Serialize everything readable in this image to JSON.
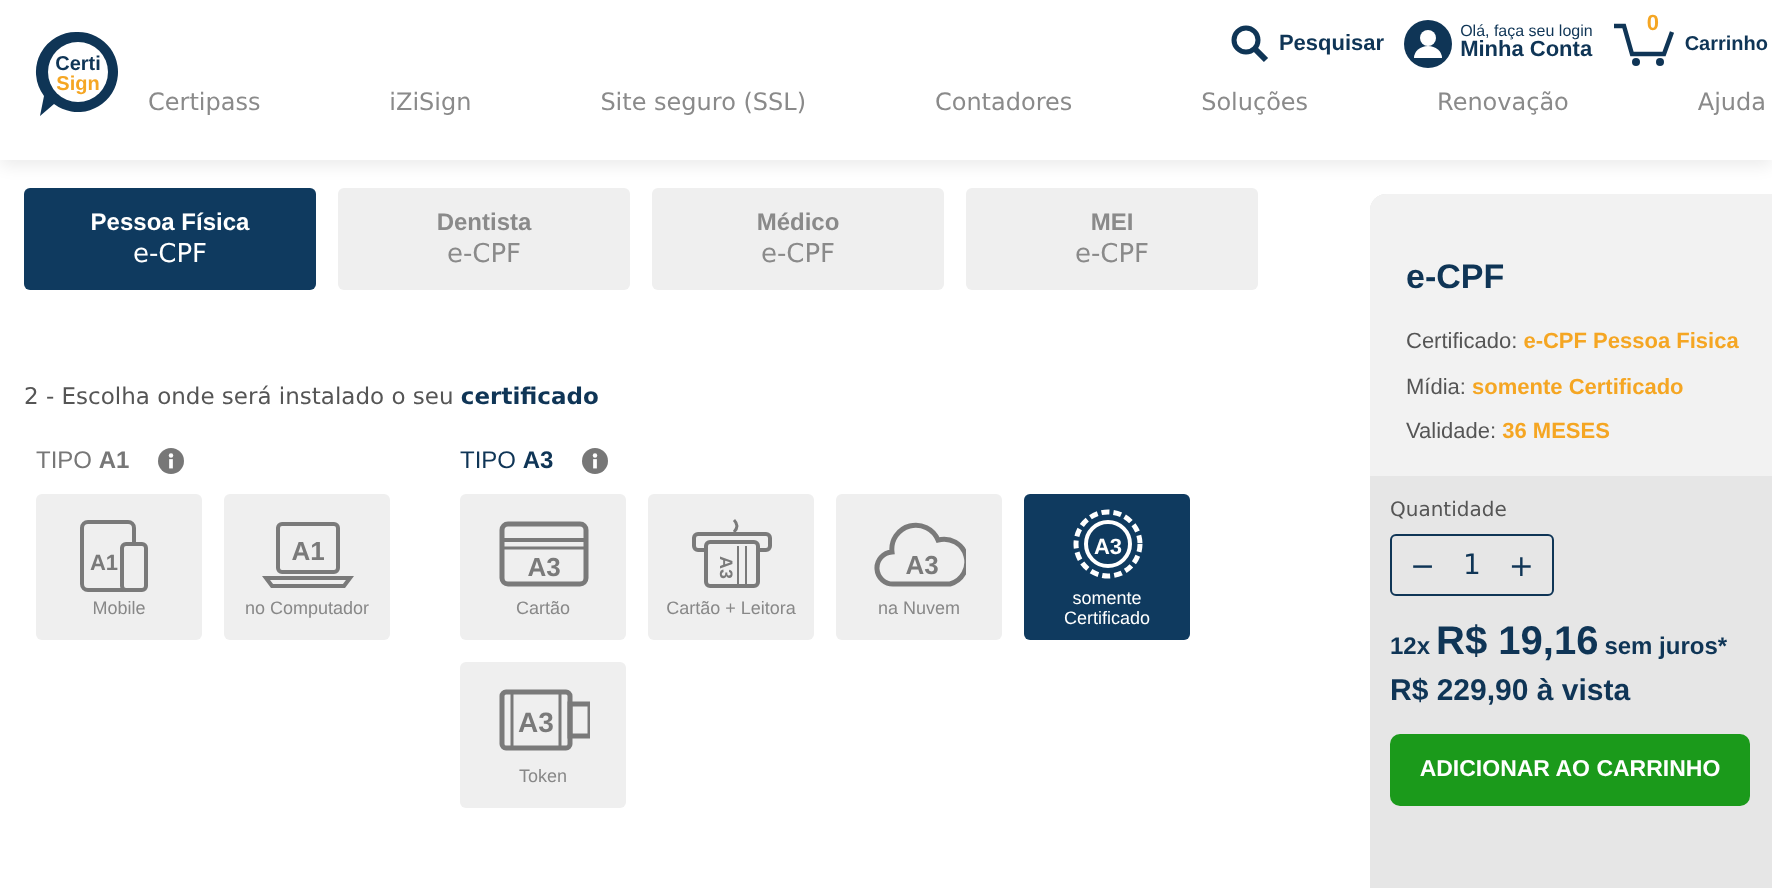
{
  "header": {
    "logo": {
      "line1": "Certi",
      "line2": "Sign"
    },
    "nav": [
      "Certipass",
      "iZiSign",
      "Site seguro (SSL)",
      "Contadores",
      "Soluções",
      "Renovação",
      "Ajuda"
    ],
    "search": {
      "label": "Pesquisar"
    },
    "account": {
      "greeting": "Olá, faça seu login",
      "label": "Minha Conta"
    },
    "cart": {
      "count": "0",
      "label": "Carrinho"
    }
  },
  "tabs": [
    {
      "title": "Pessoa Física",
      "subtitle": "e-CPF",
      "selected": true
    },
    {
      "title": "Dentista",
      "subtitle": "e-CPF",
      "selected": false
    },
    {
      "title": "Médico",
      "subtitle": "e-CPF",
      "selected": false
    },
    {
      "title": "MEI",
      "subtitle": "e-CPF",
      "selected": false
    }
  ],
  "instruction": "2 - Escolha onde será instalado o seu **certificado**",
  "groups": [
    {
      "title": "TIPO **A1**",
      "selected": false,
      "options": [
        {
          "label": "Mobile",
          "kind": "mobile",
          "badge": "A1",
          "selected": false
        },
        {
          "label": "no Computador",
          "kind": "laptop",
          "badge": "A1",
          "selected": false
        }
      ]
    },
    {
      "title": "TIPO **A3**",
      "selected": true,
      "options": [
        {
          "label": "Cartão",
          "kind": "card",
          "badge": "A3",
          "selected": false
        },
        {
          "label": "Cartão + Leitora",
          "kind": "reader",
          "badge": "A3",
          "selected": false
        },
        {
          "label": "na Nuvem",
          "kind": "cloud",
          "badge": "A3",
          "selected": false
        },
        {
          "label": "somente Certificado",
          "kind": "seal",
          "badge": "A3",
          "selected": true
        },
        {
          "label": "Token",
          "kind": "token",
          "badge": "A3",
          "selected": false
        }
      ]
    }
  ],
  "summary": {
    "title": "e-CPF",
    "details": [
      {
        "label": "Certificado:",
        "value": "e-CPF Pessoa Fisica"
      },
      {
        "label": "Mídia:",
        "value": "somente Certificado"
      },
      {
        "label": "Validade:",
        "value": "36 MESES"
      }
    ],
    "quantity": {
      "label": "Quantidade",
      "value": "1",
      "minus": "−",
      "plus": "+"
    },
    "installments": "12x",
    "price": "R$ 19,16",
    "terms": "sem juros*",
    "cash_price": "R$ 229,90 à vista",
    "button": "ADICIONAR AO CARRINHO"
  }
}
